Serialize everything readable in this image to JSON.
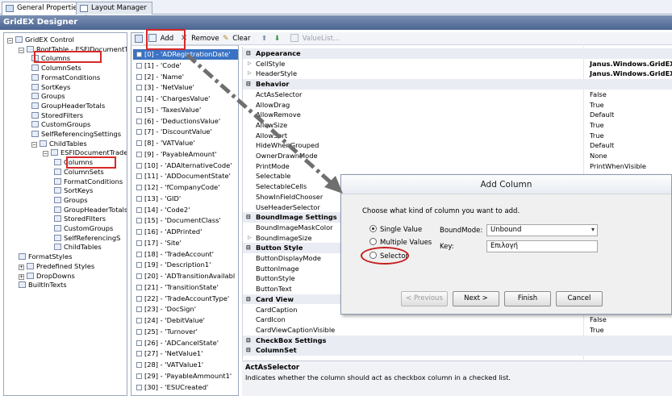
{
  "tabs": [
    {
      "label": "General Properties",
      "active": true
    },
    {
      "label": "Layout Manager",
      "active": false
    }
  ],
  "designer_title": "GridEX Designer",
  "tree": {
    "items": [
      {
        "label": "GridEX Control",
        "level": 0,
        "expanded": true
      },
      {
        "label": "RootTable - ESFIDocumentTr",
        "level": 1,
        "expanded": true
      },
      {
        "label": "Columns",
        "level": 2
      },
      {
        "label": "ColumnSets",
        "level": 2
      },
      {
        "label": "FormatConditions",
        "level": 2
      },
      {
        "label": "SortKeys",
        "level": 2
      },
      {
        "label": "Groups",
        "level": 2
      },
      {
        "label": "GroupHeaderTotals",
        "level": 2
      },
      {
        "label": "StoredFilters",
        "level": 2
      },
      {
        "label": "CustomGroups",
        "level": 2
      },
      {
        "label": "SelfReferencingSettings",
        "level": 2
      },
      {
        "label": "ChildTables",
        "level": 2,
        "expanded": true
      },
      {
        "label": "ESFIDocumentTrade",
        "level": 3,
        "expanded": true
      },
      {
        "label": "Columns",
        "level": 4
      },
      {
        "label": "ColumnSets",
        "level": 4
      },
      {
        "label": "FormatConditions",
        "level": 4
      },
      {
        "label": "SortKeys",
        "level": 4
      },
      {
        "label": "Groups",
        "level": 4
      },
      {
        "label": "GroupHeaderTotals",
        "level": 4
      },
      {
        "label": "StoredFilters",
        "level": 4
      },
      {
        "label": "CustomGroups",
        "level": 4
      },
      {
        "label": "SelfReferencingS",
        "level": 4
      },
      {
        "label": "ChildTables",
        "level": 4
      },
      {
        "label": "FormatStyles",
        "level": 1
      },
      {
        "label": "Predefined Styles",
        "level": 1,
        "collapsed": true
      },
      {
        "label": "DropDowns",
        "level": 1,
        "collapsed": true
      },
      {
        "label": "BuiltInTexts",
        "level": 1
      }
    ]
  },
  "toolbar": {
    "add": "Add",
    "remove": "Remove",
    "clear": "Clear",
    "valuelist": "ValueList..."
  },
  "columns": [
    "[0] - 'ADRegistrationDate'",
    "[1] - 'Code'",
    "[2] - 'Name'",
    "[3] - 'NetValue'",
    "[4] - 'ChargesValue'",
    "[5] - 'TaxesValue'",
    "[6] - 'DeductionsValue'",
    "[7] - 'DiscountValue'",
    "[8] - 'VATValue'",
    "[9] - 'PayableAmount'",
    "[10] - 'ADAlternativeCode'",
    "[11] - 'ADDocumentState'",
    "[12] - 'fCompanyCode'",
    "[13] - 'GID'",
    "[14] - 'Code2'",
    "[15] - 'DocumentClass'",
    "[16] - 'ADPrinted'",
    "[17] - 'Site'",
    "[18] - 'TradeAccount'",
    "[19] - 'Description1'",
    "[20] - 'ADTransitionAvailabl",
    "[21] - 'TransitionState'",
    "[22] - 'TradeAccountType'",
    "[23] - 'DocSign'",
    "[24] - 'DebitValue'",
    "[25] - 'Turnover'",
    "[26] - 'ADCancelState'",
    "[27] - 'NetValue1'",
    "[28] - 'VATValue1'",
    "[29] - 'PayableAmmount1'",
    "[30] - 'ESUCreated'",
    "[31] - 'CancelStateIcon'"
  ],
  "properties": [
    {
      "name": "Appearance",
      "cat": true
    },
    {
      "name": "CellStyle",
      "value": "Janus.Windows.GridEX.G",
      "bold": true,
      "expandable": true
    },
    {
      "name": "HeaderStyle",
      "value": "Janus.Windows.GridEX.G",
      "bold": true,
      "expandable": true
    },
    {
      "name": "Behavior",
      "cat": true
    },
    {
      "name": "ActAsSelector",
      "value": "False"
    },
    {
      "name": "AllowDrag",
      "value": "True"
    },
    {
      "name": "AllowRemove",
      "value": "Default"
    },
    {
      "name": "AllowSize",
      "value": "True"
    },
    {
      "name": "AllowSort",
      "value": "True"
    },
    {
      "name": "HideWhenGrouped",
      "value": "Default"
    },
    {
      "name": "OwnerDrawnMode",
      "value": "None"
    },
    {
      "name": "PrintMode",
      "value": "PrintWhenVisible"
    },
    {
      "name": "Selectable",
      "value": ""
    },
    {
      "name": "SelectableCells",
      "value": "lls, NewRowCells, Filt"
    },
    {
      "name": "ShowInFieldChooser",
      "value": ""
    },
    {
      "name": "UseHeaderSelector",
      "value": ""
    },
    {
      "name": "BoundImage Settings",
      "cat": true
    },
    {
      "name": "BoundImageMaskColor",
      "value": ""
    },
    {
      "name": "BoundImageSize",
      "value": "",
      "expandable": true
    },
    {
      "name": "Button Style",
      "cat": true
    },
    {
      "name": "ButtonDisplayMode",
      "value": "ctCell"
    },
    {
      "name": "ButtonImage",
      "value": "one)"
    },
    {
      "name": "ButtonStyle",
      "value": "on"
    },
    {
      "name": "ButtonText",
      "value": ""
    },
    {
      "name": "Card View",
      "cat": true
    },
    {
      "name": "CardCaption",
      "value": ""
    },
    {
      "name": "CardIcon",
      "value": "False"
    },
    {
      "name": "CardViewCaptionVisible",
      "value": "True"
    },
    {
      "name": "CheckBox Settings",
      "cat": true
    },
    {
      "name": "ColumnSet",
      "cat": true
    }
  ],
  "description": {
    "title": "ActAsSelector",
    "text": "Indicates whether the column should act as checkbox column in a checked list."
  },
  "dialog": {
    "title": "Add Column",
    "prompt": "Choose what kind of column you want to add.",
    "radio_single": "Single Value",
    "radio_multiple": "Multiple Values",
    "radio_selector": "Selector",
    "boundmode_label": "BoundMode:",
    "boundmode_value": "Unbound",
    "key_label": "Key:",
    "key_value": "Επιλογή",
    "btn_previous": "< Previous",
    "btn_next": "Next >",
    "btn_finish": "Finish",
    "btn_cancel": "Cancel"
  },
  "colors": {
    "selection": "#3b73c4",
    "annotation_red": "#d62828",
    "title_bar": "#4b6591"
  }
}
